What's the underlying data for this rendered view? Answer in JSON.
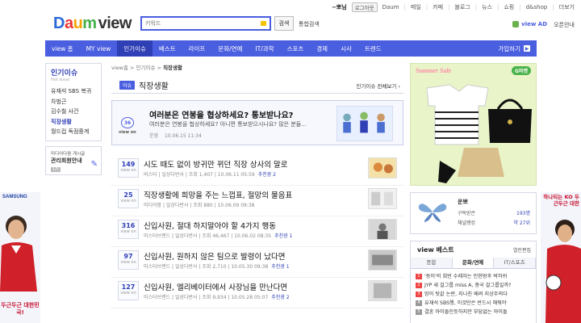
{
  "util": {
    "user": "~뽀님",
    "logout": "로그아웃",
    "links": [
      "Daum",
      "메일",
      "카페",
      "블로그",
      "뉴스",
      "쇼핑",
      "d&shop",
      "더보기"
    ]
  },
  "header": {
    "logo_parts": [
      "D",
      "a",
      "u",
      "m",
      "view"
    ],
    "search_placeholder": "키워드",
    "search_button": "검색",
    "search_all": "통합검색",
    "viewad": "view AD",
    "viewad_guide": "오픈안내"
  },
  "nav": {
    "items": [
      "view 홈",
      "MY view",
      "인기이슈",
      "베스트",
      "라이프",
      "문화/연예",
      "IT/과학",
      "스포츠",
      "경제",
      "시사",
      "트렌드"
    ],
    "login": "가입하기"
  },
  "sidebar": {
    "title": "인기이슈",
    "subtitle": "Hot Issue",
    "items": [
      "유재석 SBS 복귀",
      "차범근",
      "김수철 사건",
      "직장생활",
      "월드컵 독점중계"
    ],
    "box2_small": "미디어다음 게시글",
    "box2_bold": "관리회원안내",
    "box2_tag": "1/5"
  },
  "ads": {
    "left_brand": "SAMSUNG",
    "left_slogan": "두근두근 대한민국!",
    "right_slogan": "하나되는 KO 두근두근 대한"
  },
  "main": {
    "crumbs": [
      "view홈",
      "인기이슈",
      "직장생활"
    ],
    "badge": "이슈",
    "title": "직장생활",
    "view_all": "인기이슈 전체보기",
    "featured": {
      "count": "36",
      "count_label": "view on",
      "title": "여러분은 연봉을 협상하세요? 통보받나요?",
      "summary": "여러분은 연봉을 협상하세요? 아니면 통보받으시나요? 많은 분들...",
      "author": "운영",
      "date": "10.06.15 11:34"
    },
    "rows": [
      {
        "count": "149",
        "label": "view on",
        "title": "시도 때도 없이 방귀만 뀌던 직장 상사의 말로",
        "meta": "비스터 | 일상다반사 | 조회 1,407 | 10.06.11 05:59",
        "rec": "추천광 2"
      },
      {
        "count": "25",
        "label": "view on",
        "title": "직장생활에 희망을 주는 느껍표, 절망의 물음표",
        "meta": "미디어팜 | 일상다반사 | 조회 880 | 10.06.09 09:38",
        "rec": ""
      },
      {
        "count": "316",
        "label": "view on",
        "title": "신입사원, 절대 하지말아야 할 4가지 행동",
        "meta": "미스터브랜드 | 일상다반사 | 조회 46,467 | 10.06.02 08:35",
        "rec": "추천광 1"
      },
      {
        "count": "97",
        "label": "view on",
        "title": "신입사원, 원하지 않은 팀으로 발령이 났다면",
        "meta": "미스터브랜드 | 일상다반사 | 조회 2,710 | 10.05.30 09:38",
        "rec": "추천광 1"
      },
      {
        "count": "127",
        "label": "view on",
        "title": "신입사원, 엘리베이터에서 사장님을 만난다면",
        "meta": "미스터브랜드 | 일상다반사 | 조회 9,934 | 10.05.28 05:07",
        "rec": "추천광 2"
      }
    ]
  },
  "right": {
    "ad_title": "Summer Sale",
    "ad_brand": "G마켓",
    "user_name": "운뽀",
    "user_rows": [
      {
        "label": "구독받은",
        "value": "193명"
      },
      {
        "label": "채널랭킹",
        "value": "약 27위"
      }
    ],
    "best_title": "view 베스트",
    "best_howto": "열린편집",
    "tabs": [
      "종합",
      "문화/연예",
      "IT/스포츠"
    ],
    "best_items": [
      {
        "num": "1",
        "text": "'동이'의 희빈 수레자는 인현왕후 박하쉬"
      },
      {
        "num": "2",
        "text": "JYP 새 걸그룹 miss A, 중국 걸그룹일까?"
      },
      {
        "num": "3",
        "text": "망이 탓값 논란, 지나친 배려 지상주의다"
      },
      {
        "num": "4",
        "text": "유재석 SBS행, 이것만은 반드시 해줘야"
      },
      {
        "num": "5",
        "text": "결혼 아이돌인듯하지만 부담없는 아이돌"
      }
    ]
  }
}
